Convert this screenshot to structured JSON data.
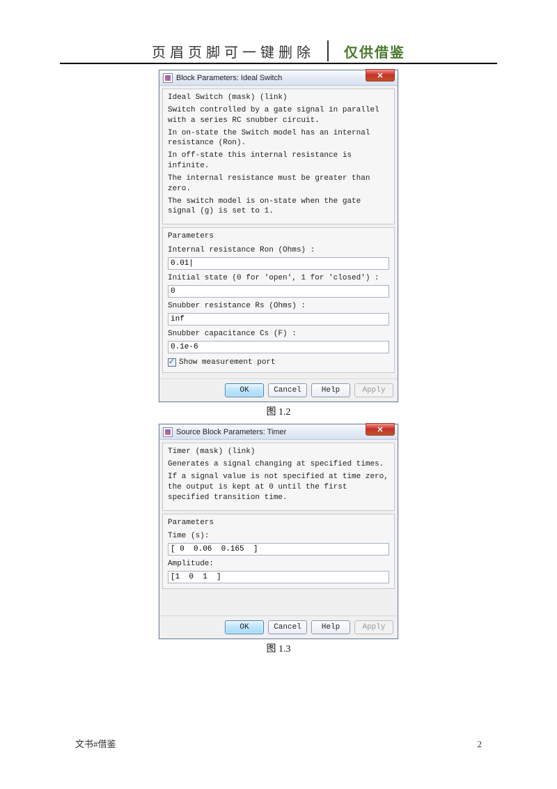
{
  "header": {
    "left": "页眉页脚可一键删除",
    "right": "仅供借鉴"
  },
  "dlg1": {
    "title": "Block Parameters: Ideal Switch",
    "desc_title": "Ideal Switch (mask) (link)",
    "desc_l1": "Switch controlled by a gate signal in parallel with a series RC snubber circuit.",
    "desc_l2": "In on-state the Switch model has an internal resistance (Ron).",
    "desc_l3": "  In off-state this internal resistance is infinite.",
    "desc_l4": "The internal resistance must be greater than zero.",
    "desc_l5": "The switch model is on-state when the gate signal (g) is set to 1.",
    "params_title": "Parameters",
    "f1_label": "Internal resistance Ron (Ohms) :",
    "f1_value": "0.01|",
    "f2_label": "Initial state (0 for 'open', 1 for 'closed') :",
    "f2_value": "0",
    "f3_label": "Snubber resistance Rs (Ohms) :",
    "f3_value": "inf",
    "f4_label": "Snubber capacitance Cs (F) :",
    "f4_value": "0.1e-6",
    "chk_label": "Show measurement port",
    "btn_ok": "OK",
    "btn_cancel": "Cancel",
    "btn_help": "Help",
    "btn_apply": "Apply"
  },
  "caption1_a": "图 ",
  "caption1_b": "1.2",
  "dlg2": {
    "title": "Source Block Parameters: Timer",
    "desc_title": "Timer (mask) (link)",
    "desc_l1": "Generates a signal changing at specified times.",
    "desc_l2": "If a signal value is not specified at time zero, the output is kept at 0 until the first specified transition time.",
    "params_title": "Parameters",
    "f1_label": "Time (s):",
    "f1_value": "[ 0  0.06  0.165  ]",
    "f2_label": "Amplitude:",
    "f2_value": "[1  0  1  ]",
    "btn_ok": "OK",
    "btn_cancel": "Cancel",
    "btn_help": "Help",
    "btn_apply": "Apply"
  },
  "caption2_a": "图 ",
  "caption2_b": "1.3",
  "footer": {
    "left": "文书#借鉴",
    "right": "2"
  }
}
